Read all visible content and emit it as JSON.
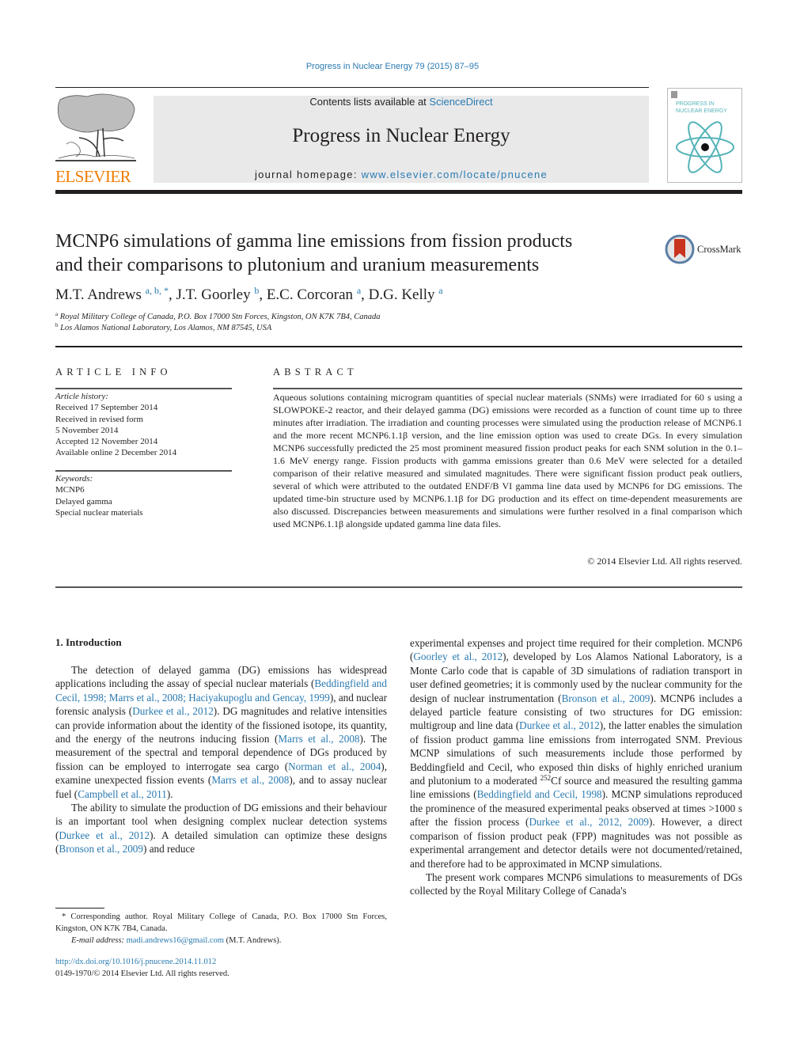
{
  "running_head": "Progress in Nuclear Energy 79 (2015) 87–95",
  "banner": {
    "contents_prefix": "Contents lists available at ",
    "contents_link": "ScienceDirect",
    "journal_name": "Progress in Nuclear Energy",
    "homepage_prefix": "journal homepage: ",
    "homepage_link": "www.elsevier.com/locate/pnucene"
  },
  "publisher_logo": {
    "word": "ELSEVIER",
    "icon": "tree-logo-icon",
    "color": "#f07c00"
  },
  "cover": {
    "title_line1": "PROGRESS IN",
    "title_line2": "NUCLEAR ENERGY",
    "icon": "atom-icon",
    "color": "#54b3b8"
  },
  "crossmark": {
    "label": "CrossMark",
    "icon": "crossmark-icon"
  },
  "article": {
    "title_line1": "MCNP6 simulations of gamma line emissions from fission products",
    "title_line2": "and their comparisons to plutonium and uranium measurements",
    "authors": [
      {
        "name": "M.T. Andrews",
        "sup": "a, b, *",
        "sep": ", "
      },
      {
        "name": "J.T. Goorley",
        "sup": "b",
        "sep": ", "
      },
      {
        "name": "E.C. Corcoran",
        "sup": "a",
        "sep": ", "
      },
      {
        "name": "D.G. Kelly",
        "sup": "a",
        "sep": ""
      }
    ],
    "affiliations": [
      {
        "mark": "a",
        "text": "Royal Military College of Canada, P.O. Box 17000 Stn Forces, Kingston, ON K7K 7B4, Canada"
      },
      {
        "mark": "b",
        "text": "Los Alamos National Laboratory, Los Alamos, NM 87545, USA"
      }
    ]
  },
  "article_info": {
    "heading": "ARTICLE INFO",
    "history_label": "Article history:",
    "history": [
      "Received 17 September 2014",
      "Received in revised form",
      "5 November 2014",
      "Accepted 12 November 2014",
      "Available online 2 December 2014"
    ],
    "keywords_label": "Keywords:",
    "keywords": [
      "MCNP6",
      "Delayed gamma",
      "Special nuclear materials"
    ]
  },
  "abstract": {
    "heading": "ABSTRACT",
    "text": "Aqueous solutions containing microgram quantities of special nuclear materials (SNMs) were irradiated for 60 s using a SLOWPOKE-2 reactor, and their delayed gamma (DG) emissions were recorded as a function of count time up to three minutes after irradiation. The irradiation and counting processes were simulated using the production release of MCNP6.1 and the more recent MCNP6.1.1β version, and the line emission option was used to create DGs. In every simulation MCNP6 successfully predicted the 25 most prominent measured fission product peaks for each SNM solution in the 0.1–1.6 MeV energy range. Fission products with gamma emissions greater than 0.6 MeV were selected for a detailed comparison of their relative measured and simulated magnitudes. There were significant fission product peak outliers, several of which were attributed to the outdated ENDF/B VI gamma line data used by MCNP6 for DG emissions. The updated time-bin structure used by MCNP6.1.1β for DG production and its effect on time-dependent measurements are also discussed. Discrepancies between measurements and simulations were further resolved in a final comparison which used MCNP6.1.1β alongside updated gamma line data files.",
    "copyright": "© 2014 Elsevier Ltd. All rights reserved."
  },
  "intro": {
    "heading": "1.  Introduction",
    "p1": [
      {
        "t": "The detection of delayed gamma (DG) emissions has widespread applications including the assay of special nuclear materials ("
      },
      {
        "l": "Beddingfield and Cecil, 1998; Marrs et al., 2008; Haciyakupoglu and Gencay, 1999"
      },
      {
        "t": "), and nuclear forensic analysis ("
      },
      {
        "l": "Durkee et al., 2012"
      },
      {
        "t": "). DG magnitudes and relative intensities can provide infor­mation about the identity of the fissioned isotope, its quantity, and the energy of the neutrons inducing fission ("
      },
      {
        "l": "Marrs et al., 2008"
      },
      {
        "t": "). The measurement of the spectral and temporal dependence of DGs produced by fission can be employed to interrogate sea cargo ("
      },
      {
        "l": "Norman et al., 2004"
      },
      {
        "t": "), examine unexpected fission events ("
      },
      {
        "l": "Marrs et al., 2008"
      },
      {
        "t": "), and to assay nuclear fuel ("
      },
      {
        "l": "Campbell et al., 2011"
      },
      {
        "t": ")."
      }
    ],
    "p2": [
      {
        "t": "The ability to simulate the production of DG emissions and their behaviour is an important tool when designing complex nuclear detection systems ("
      },
      {
        "l": "Durkee et al., 2012"
      },
      {
        "t": "). A detailed simulation can optimize these designs ("
      },
      {
        "l": "Bronson et al., 2009"
      },
      {
        "t": ") and reduce experimental expenses and project time required for their completion. MCNP6 ("
      },
      {
        "l": "Goorley et al., 2012"
      },
      {
        "t": "), developed by Los Alamos National Laboratory, is a Monte Carlo code that is capable of 3D simulations of radiation transport in user defined geometries; it is commonly used by the nuclear community for the design of nuclear instrumentation ("
      },
      {
        "l": "Bronson et al., 2009"
      },
      {
        "t": "). MCNP6 includes a delayed particle feature consisting of two structures for DG emission: multigroup and line data ("
      },
      {
        "l": "Durkee et al., 2012"
      },
      {
        "t": "), the latter enables the simulation of fission product gamma line emissions from interro­gated SNM. Previous MCNP simulations of such measurements include those performed by Beddingfield and Cecil, who exposed thin disks of highly enriched uranium and plutonium to a moder­ated "
      },
      {
        "sup": "252"
      },
      {
        "t": "Cf source and measured the resulting gamma line emissions ("
      },
      {
        "l": "Beddingfield and Cecil, 1998"
      },
      {
        "t": "). MCNP simulations reproduced the prominence of the measured experimental peaks observed at times >1000 s after the fission process ("
      },
      {
        "l": "Durkee et al., 2012, 2009"
      },
      {
        "t": "). However, a direct comparison of fission product peak (FPP) mag­nitudes was not possible as experimental arrangement and detec­tor details were not documented/retained, and therefore had to be approximated in MCNP simulations."
      }
    ],
    "p3": [
      {
        "t": "The present work compares MCNP6 simulations to measure­ments of DGs collected by the Royal Military College of Canada's"
      }
    ]
  },
  "footnote": {
    "star": "*",
    "corresponding": " Corresponding author. Royal Military College of Canada, P.O. Box 17000 Stn Forces, Kingston, ON K7K 7B4, Canada.",
    "email_label": "E-mail address:",
    "email": "madi.andrews16@gmail.com",
    "email_suffix": " (M.T. Andrews)."
  },
  "doi": "http://dx.doi.org/10.1016/j.pnucene.2014.11.012",
  "issn": "0149-1970/© 2014 Elsevier Ltd. All rights reserved."
}
